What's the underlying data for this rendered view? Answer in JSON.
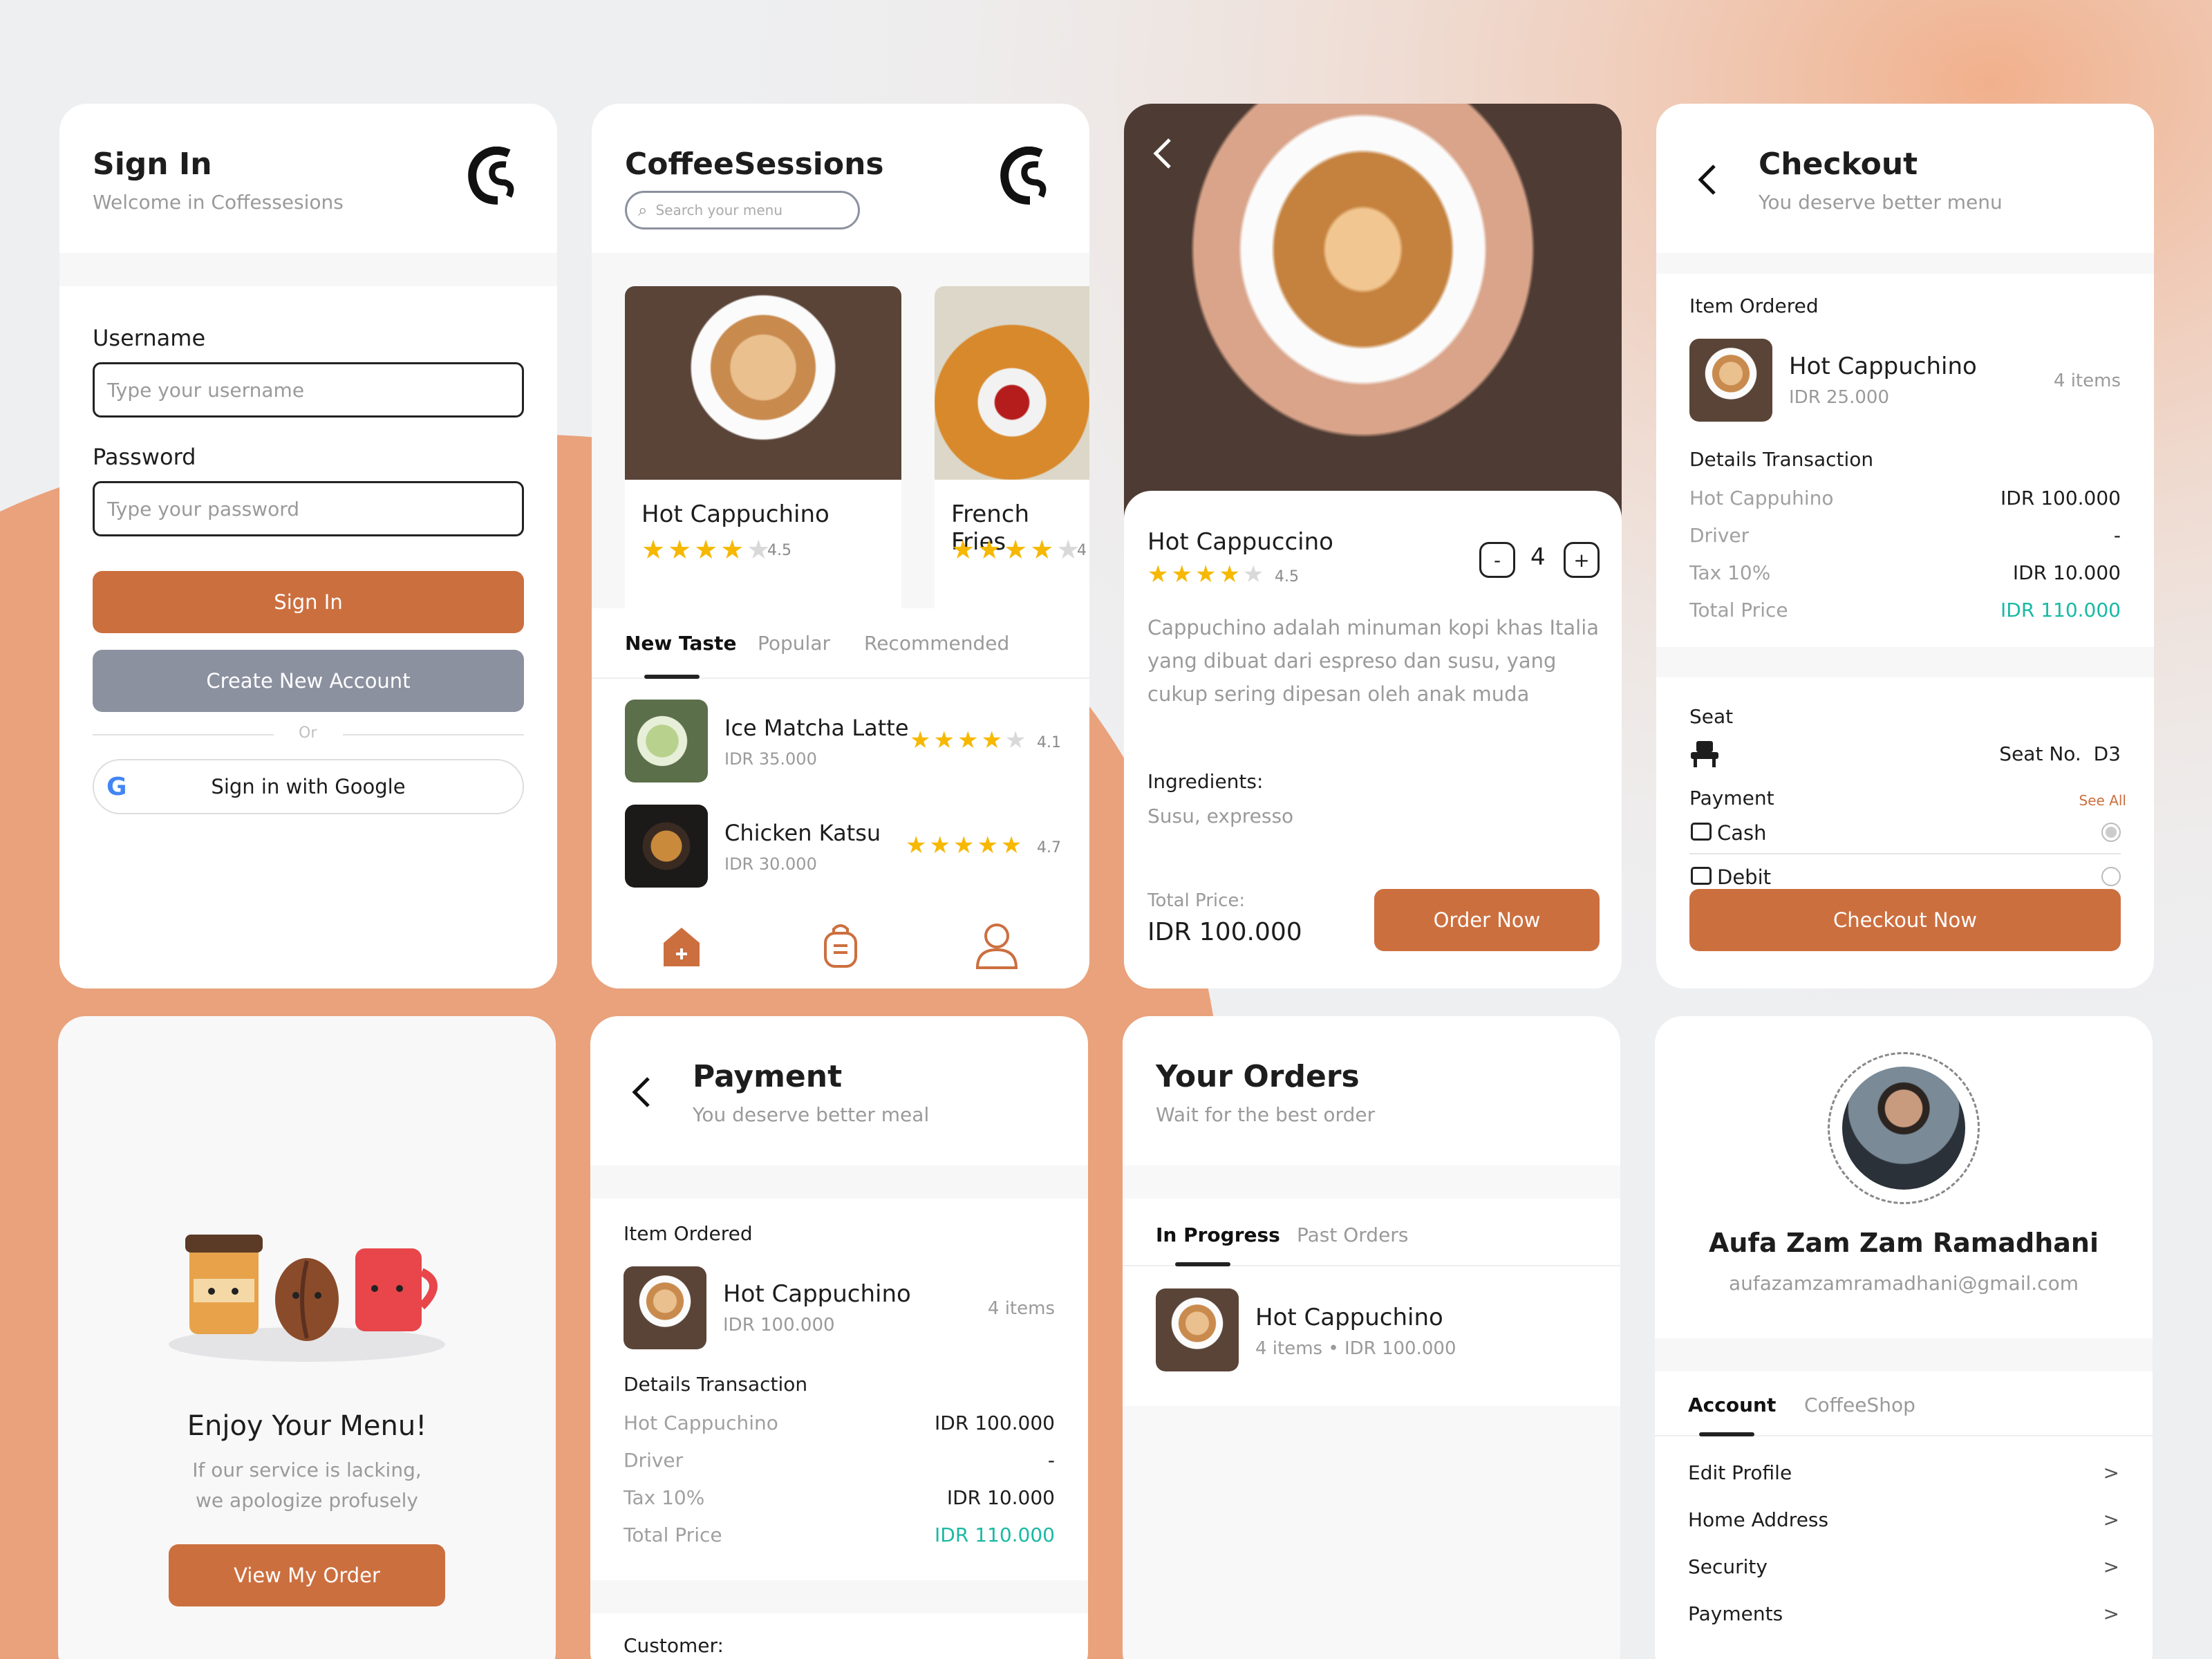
{
  "colors": {
    "accent": "#cc6f3f",
    "gray_button": "#8c91a0",
    "teal": "#19b9a3",
    "star": "#f6b800",
    "background": "#eeeff1",
    "peach": "#e9a27c"
  },
  "signin": {
    "title": "Sign In",
    "subtitle": "Welcome in Coffessesions",
    "logo": "CS",
    "username_label": "Username",
    "username_placeholder": "Type your username",
    "password_label": "Password",
    "password_placeholder": "Type your password",
    "signin_button": "Sign In",
    "create_button": "Create New Account",
    "or": "Or",
    "google_button": "Sign in with Google",
    "google_icon": "G"
  },
  "home": {
    "title": "CoffeeSessions",
    "search_placeholder": "Search your menu",
    "logo": "CS",
    "featured": [
      {
        "name": "Hot Cappuchino",
        "rating": "4.5",
        "stars": 4
      },
      {
        "name": "French Fries",
        "rating": "4",
        "stars": 4
      }
    ],
    "tabs": [
      "New Taste",
      "Popular",
      "Recommended"
    ],
    "items": [
      {
        "name": "Ice Matcha Latte",
        "price": "IDR 35.000",
        "rating": "4.1",
        "stars": 4
      },
      {
        "name": "Chicken Katsu",
        "price": "IDR 30.000",
        "rating": "4.7",
        "stars": 5
      }
    ],
    "nav_icons": [
      "home-icon",
      "bag-icon",
      "profile-icon"
    ]
  },
  "detail": {
    "name": "Hot Cappuccino",
    "rating": "4.5",
    "stars": 4,
    "qty": "4",
    "minus": "-",
    "plus": "+",
    "description": "Cappuchino adalah minuman kopi khas Italia yang dibuat dari espreso dan susu, yang cukup sering dipesan oleh anak muda",
    "ingredients_label": "Ingredients:",
    "ingredients": "Susu, expresso",
    "total_label": "Total Price:",
    "total": "IDR 100.000",
    "order_button": "Order Now"
  },
  "checkout": {
    "title": "Checkout",
    "subtitle": "You deserve better menu",
    "item_ordered_label": "Item Ordered",
    "item_name": "Hot Cappuchino",
    "item_price": "IDR 25.000",
    "item_count": "4 items",
    "details_label": "Details Transaction",
    "rows": [
      {
        "label": "Hot Cappuhino",
        "value": "IDR 100.000"
      },
      {
        "label": "Driver",
        "value": "-"
      },
      {
        "label": "Tax 10%",
        "value": "IDR 10.000"
      },
      {
        "label": "Total Price",
        "value": "IDR 110.000"
      }
    ],
    "seat_label": "Seat",
    "seat_value": "Seat No.  D3",
    "payment_label": "Payment",
    "see_all": "See All",
    "payment_options": [
      "Cash",
      "Debit"
    ],
    "checkout_button": "Checkout Now"
  },
  "enjoy": {
    "title": "Enjoy Your Menu!",
    "line1": "If our service is lacking,",
    "line2": "we apologize profusely",
    "button": "View My Order"
  },
  "payment": {
    "title": "Payment",
    "subtitle": "You deserve better meal",
    "item_ordered_label": "Item Ordered",
    "item_name": "Hot Cappuchino",
    "item_price": "IDR 100.000",
    "item_count": "4 items",
    "details_label": "Details Transaction",
    "rows": [
      {
        "label": "Hot Cappuchino",
        "value": "IDR 100.000"
      },
      {
        "label": "Driver",
        "value": "-"
      },
      {
        "label": "Tax 10%",
        "value": "IDR 10.000"
      },
      {
        "label": "Total Price",
        "value": "IDR 110.000"
      }
    ],
    "customer_label": "Customer:"
  },
  "orders": {
    "title": "Your Orders",
    "subtitle": "Wait for the best order",
    "tabs": [
      "In Progress",
      "Past Orders"
    ],
    "item_name": "Hot Cappuchino",
    "item_meta": "4 items • IDR 100.000"
  },
  "profile": {
    "name": "Aufa Zam Zam Ramadhani",
    "email": "aufazamzamramadhani@gmail.com",
    "tabs": [
      "Account",
      "CoffeeShop"
    ],
    "menu": [
      "Edit Profile",
      "Home Address",
      "Security",
      "Payments"
    ]
  }
}
